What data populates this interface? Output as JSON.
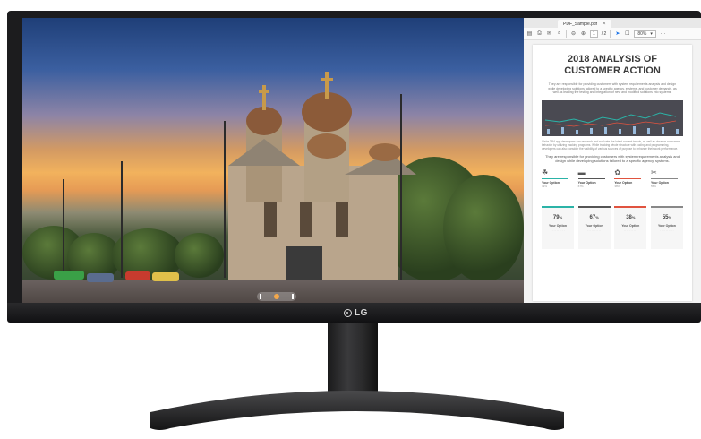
{
  "device": {
    "brand": "LG"
  },
  "pdf_viewer": {
    "tab_title": "PDF_Sample.pdf",
    "tab_close": "×",
    "page_number": "1",
    "page_total": "/ 2",
    "zoom": "80%",
    "more": "···"
  },
  "document": {
    "title_line1": "2018 ANALYSIS OF",
    "title_line2": "CUSTOMER ACTION",
    "intro": "They are responsible for providing customers with system requirements analysis and design while developing solutions tailored to a specific agency, systems, and customer demands, as well as leading the testing and integration of new and modified solutions into systems.",
    "body": "We're TBA app developers can research and evaluate the latest content trends, as well as observe consumer behavior by utilizing tracking programs. While tracking whole structure with coding and programming, developers can also consider the visibility of various sources of purpose to enhance their work performance.",
    "subheading": "They are responsible for providing customers with system requirements analysis and design while developing solutions tailored to a specific agency, systems.",
    "options": [
      {
        "icon": "☘",
        "label": "Your Option",
        "pct": "79%",
        "color": "#2bb3a7"
      },
      {
        "icon": "▬",
        "label": "Your Option",
        "pct": "67%",
        "color": "#555555"
      },
      {
        "icon": "✿",
        "label": "Your Option",
        "pct": "38%",
        "color": "#e0533f"
      },
      {
        "icon": "✂",
        "label": "Your Option",
        "pct": "55%",
        "color": "#888888"
      }
    ],
    "stats": [
      {
        "value": "79",
        "unit": "%",
        "label": "Your Option",
        "color": "#2bb3a7"
      },
      {
        "value": "67",
        "unit": "%",
        "label": "Your Option",
        "color": "#555555"
      },
      {
        "value": "38",
        "unit": "%",
        "label": "Your Option",
        "color": "#e0533f"
      },
      {
        "value": "55",
        "unit": "%",
        "label": "Your Option",
        "color": "#888888"
      }
    ]
  },
  "colors": {
    "accent": "#1a73e8",
    "bezel": "#1c1c1e"
  }
}
